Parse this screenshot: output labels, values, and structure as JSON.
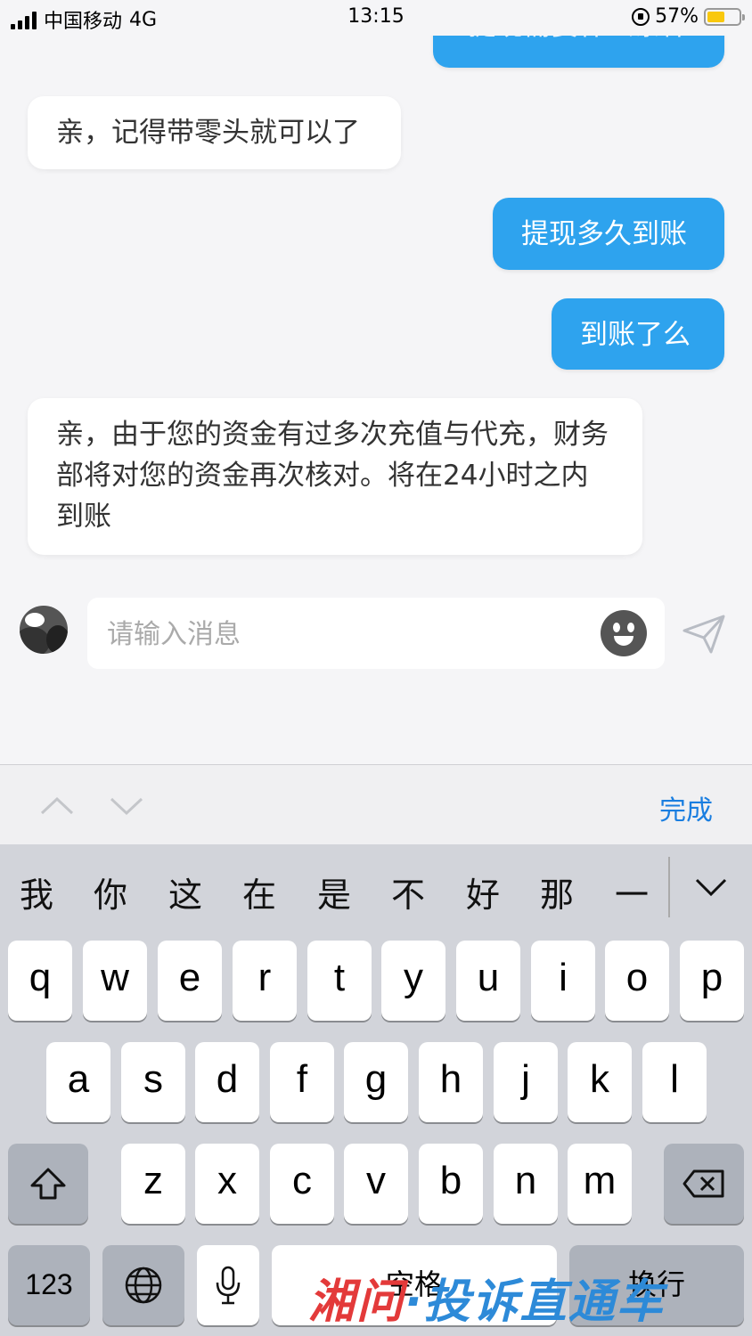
{
  "status_bar": {
    "carrier": "中国移动",
    "network": "4G",
    "time": "13:15",
    "battery_percent": "57%",
    "battery_level": 0.57
  },
  "chat": {
    "messages": [
      {
        "direction": "outgoing",
        "text": "提现需要什么条件"
      },
      {
        "direction": "incoming",
        "text": "亲，记得带零头就可以了"
      },
      {
        "direction": "outgoing",
        "text": "提现多久到账"
      },
      {
        "direction": "outgoing",
        "text": "到账了么"
      },
      {
        "direction": "incoming",
        "text": "亲，由于您的资金有过多次充值与代充，财务部将对您的资金再次核对。将在24小时之内到账"
      }
    ]
  },
  "input": {
    "placeholder": "请输入消息",
    "value": ""
  },
  "toolbar": {
    "done_label": "完成"
  },
  "keyboard": {
    "candidates": [
      "我",
      "你",
      "这",
      "在",
      "是",
      "不",
      "好",
      "那",
      "一"
    ],
    "row1": [
      "q",
      "w",
      "e",
      "r",
      "t",
      "y",
      "u",
      "i",
      "o",
      "p"
    ],
    "row2": [
      "a",
      "s",
      "d",
      "f",
      "g",
      "h",
      "j",
      "k",
      "l"
    ],
    "row3": [
      "z",
      "x",
      "c",
      "v",
      "b",
      "n",
      "m"
    ],
    "numbers_label": "123",
    "space_label": "空格",
    "return_label": "换行"
  },
  "watermark": {
    "part1": "湘问",
    "part2": "·投诉直通车"
  },
  "colors": {
    "outgoing_bubble": "#2ea3ee",
    "incoming_bubble": "#ffffff",
    "accent": "#1a7ee0"
  }
}
